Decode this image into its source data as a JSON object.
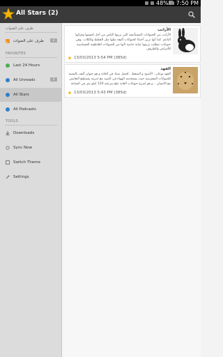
{
  "status": {
    "battery": "48%",
    "time": "7:50 PM"
  },
  "header": {
    "title": "All Stars (2)"
  },
  "sidebar": {
    "top_label": "طرف على الصوات",
    "feed": {
      "label": "طرف على الصوات",
      "count": "2"
    },
    "favorites_title": "FAVORITES",
    "favorites": [
      {
        "label": "Last 24 Hours",
        "color": "#4caf50"
      },
      {
        "label": "All Unreads",
        "color": "#2e80c9",
        "count": "2"
      },
      {
        "label": "All Stars",
        "color": "#2e80c9"
      },
      {
        "label": "All Podcasts",
        "color": "#2e80c9"
      }
    ],
    "tools_title": "TOOLS",
    "tools": [
      {
        "label": "Downloads"
      },
      {
        "label": "Sync Now"
      },
      {
        "label": "Switch Theme"
      },
      {
        "label": "Settings"
      }
    ]
  },
  "articles": [
    {
      "title": "الأرانب",
      "body": "الأرانب من الحيوانات المستأنسة التي يربيها الناس من أجل لحومها وفرائها الناعم. كما أنها تربى أحيانا كحيوانات أليفة مثلها مثل القطط والكلاب. وهي حيوانات تتطلب تربيتها عناية خاصة لأنها من الحيوانات العاطفية الحساسية للأمراض والظروف",
      "date": "13/03/2013 5:54 PM (385d)",
      "thumb": "rabbit"
    },
    {
      "title": "الفهد",
      "body": "الفهد نوعان : الأسود و المنقط ..أفضل صياد في الغابة و هو حيوان أليف بالنسبة للحيوانات المفترسة حيث يستخدمه الهواة في الصيد مع تدريبه يستطيع التعايش مع الانسان .. و هو اسرع حيوانات الغابة تبلغ سرعته 120 كيلو متر في الساعة",
      "date": "13/03/2013 5:43 PM (385d)",
      "thumb": "cheetah"
    }
  ]
}
